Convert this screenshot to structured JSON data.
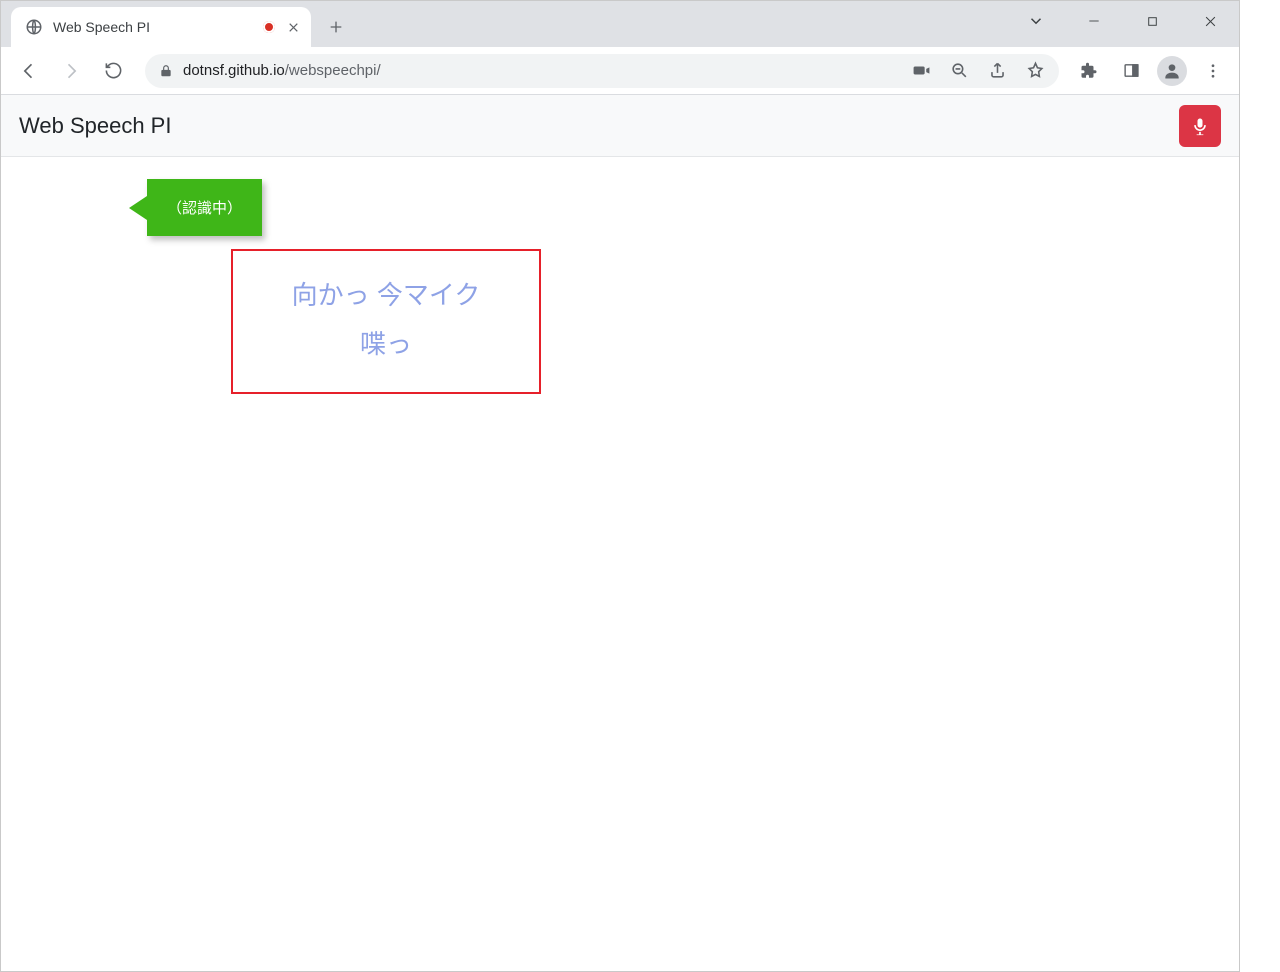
{
  "browser": {
    "tab_title": "Web Speech PI",
    "url_host": "dotnsf.github.io",
    "url_path": "/webspeechpi/"
  },
  "app": {
    "title": "Web Speech PI",
    "status_label": "（認識中）",
    "speech_text": "向かっ 今マイク\n喋っ"
  }
}
